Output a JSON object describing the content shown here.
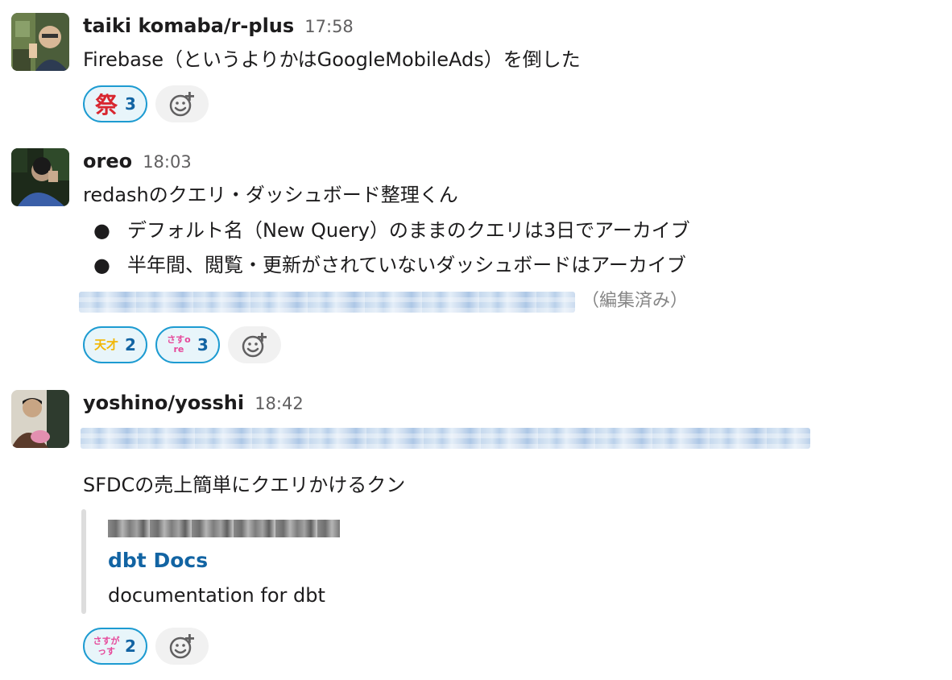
{
  "messages": [
    {
      "author": "taiki komaba/r-plus",
      "time": "17:58",
      "text": "Firebase（というよりかはGoogleMobileAds）を倒した",
      "reactions": [
        {
          "emoji": "matsuri-icon",
          "glyph": "祭",
          "count": "3"
        }
      ]
    },
    {
      "author": "oreo",
      "time": "18:03",
      "text": "redashのクエリ・ダッシュボード整理くん",
      "bullets": [
        "デフォルト名（New Query）のままのクエリは3日でアーカイブ",
        "半年間、閲覧・更新がされていないダッシュボードはアーカイブ"
      ],
      "edited": "（編集済み）",
      "reactions": [
        {
          "emoji": "tensai-icon",
          "glyph": "天才",
          "count": "2"
        },
        {
          "emoji": "sasuore-icon",
          "glyph": "さすore",
          "count": "3"
        }
      ]
    },
    {
      "author": "yoshino/yosshi",
      "time": "18:42",
      "text": "SFDCの売上簡単にクエリかけるクン",
      "attachment": {
        "title": "dbt Docs",
        "description": "documentation for dbt"
      },
      "reactions": [
        {
          "emoji": "sasugatsusu-icon",
          "glyph": "さすがっす",
          "count": "2"
        }
      ]
    }
  ],
  "colors": {
    "reaction_border": "#1d9bd1",
    "reaction_bg": "#e8f5fa",
    "link": "#1264a3",
    "timestamp": "#616061"
  }
}
